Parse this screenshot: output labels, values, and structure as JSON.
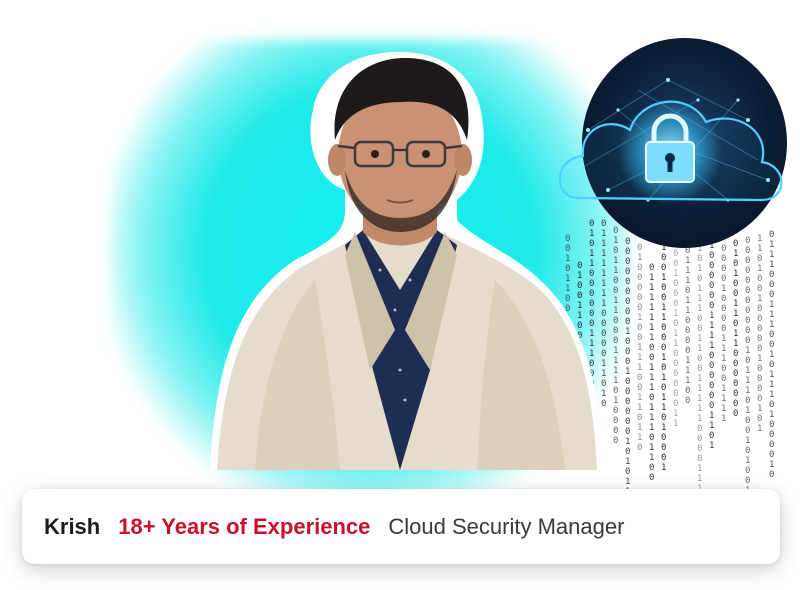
{
  "profile": {
    "name": "Krish",
    "experience": "18+ Years of Experience",
    "role": "Cloud Security Manager"
  },
  "colors": {
    "glow": "#1fe9e9",
    "experience_text": "#c8102e",
    "name_text": "#1c1c1c",
    "role_text": "#3a3a3a",
    "cloud_lock": "#39c8ff"
  },
  "icons": [
    "cloud-lock-icon"
  ]
}
